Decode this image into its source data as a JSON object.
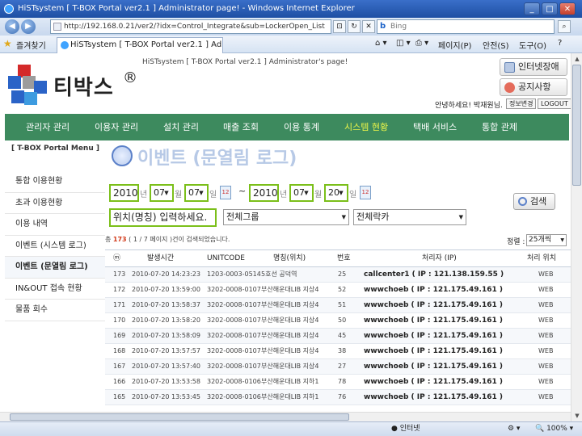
{
  "window": {
    "title": "HiSTsystem [ T-BOX Portal ver2.1 ] Administrator page! - Windows Internet Explorer"
  },
  "browser": {
    "url": "http://192.168.0.21/ver2/?idx=Control_Integrate&sub=LockerOpen_List",
    "search_placeholder": "Bing",
    "favorites_label": "즐겨찾기",
    "tab_title": "HiSTsystem [ T-BOX Portal ver2.1 ] Adminis...",
    "commands": [
      "페이지(P)",
      "안전(S)",
      "도구(O)"
    ]
  },
  "header": {
    "site_title": "HiSTsystem [ T-BOX Portal ver2.1 ] Administrator's page!",
    "logo_text": "티박스",
    "logo_mark": "®",
    "btn_internet": "인터넷장애",
    "btn_notice": "공지사항",
    "user_greeting": "안녕하세요! 박재원님.",
    "btn_info_change": "정보변경",
    "btn_logout": "LOGOUT"
  },
  "main_nav": [
    "관리자 관리",
    "이용자 관리",
    "설치 관리",
    "매출 조회",
    "이용 통계",
    "시스템 현황",
    "택배 서비스",
    "통합 관제"
  ],
  "main_nav_active": "시스템 현황",
  "sidebar": {
    "title": "[ T-BOX Portal Menu ]",
    "items": [
      "통합 이용현황",
      "초과 이용현황",
      "이용 내역",
      "이벤트 (시스템 로그)",
      "이벤트 (문열림 로그)",
      "IN&OUT 접속 현황",
      "물품 회수"
    ],
    "active_index": 4
  },
  "page": {
    "title": "이벤트 (문열림 로그)"
  },
  "filter": {
    "start_year": "2010",
    "start_month": "07",
    "start_day": "07",
    "end_year": "2010",
    "end_month": "07",
    "end_day": "20",
    "unit_year": "년",
    "unit_month": "월",
    "unit_day": "일",
    "tilde": "~",
    "location_placeholder": "위치(명칭) 입력하세요.",
    "group_select": "전체그룹",
    "locker_select": "전체락카",
    "search_button": "검색",
    "cal_icon_text": "12"
  },
  "result": {
    "prefix": "총",
    "total": "173",
    "page_info": "( 1 / 7 페이지 )건이 검색되었습니다.",
    "sort_label": "정렬 :",
    "sort_value": "25개씩"
  },
  "table": {
    "headers": [
      "ⓜ",
      "발생시간",
      "UNITCODE",
      "명칭(위치)",
      "번호",
      "처리자 (IP)",
      "처리 위치"
    ],
    "rows": [
      [
        "173",
        "2010-07-20 14:23:23",
        "1203-0003-0514",
        "5호선 공덕역",
        "25",
        "callcenter1 ( IP : 121.138.159.55 )",
        "WEB"
      ],
      [
        "172",
        "2010-07-20 13:59:00",
        "3202-0008-0107",
        "부산해운대LIB 지상4",
        "52",
        "wwwchoeb ( IP : 121.175.49.161 )",
        "WEB"
      ],
      [
        "171",
        "2010-07-20 13:58:37",
        "3202-0008-0107",
        "부산해운대LIB 지상4",
        "51",
        "wwwchoeb ( IP : 121.175.49.161 )",
        "WEB"
      ],
      [
        "170",
        "2010-07-20 13:58:20",
        "3202-0008-0107",
        "부산해운대LIB 지상4",
        "50",
        "wwwchoeb ( IP : 121.175.49.161 )",
        "WEB"
      ],
      [
        "169",
        "2010-07-20 13:58:09",
        "3202-0008-0107",
        "부산해운대LIB 지상4",
        "45",
        "wwwchoeb ( IP : 121.175.49.161 )",
        "WEB"
      ],
      [
        "168",
        "2010-07-20 13:57:57",
        "3202-0008-0107",
        "부산해운대LIB 지상4",
        "38",
        "wwwchoeb ( IP : 121.175.49.161 )",
        "WEB"
      ],
      [
        "167",
        "2010-07-20 13:57:40",
        "3202-0008-0107",
        "부산해운대LIB 지상4",
        "27",
        "wwwchoeb ( IP : 121.175.49.161 )",
        "WEB"
      ],
      [
        "166",
        "2010-07-20 13:53:58",
        "3202-0008-0106",
        "부산해운대LIB 지하1",
        "78",
        "wwwchoeb ( IP : 121.175.49.161 )",
        "WEB"
      ],
      [
        "165",
        "2010-07-20 13:53:45",
        "3202-0008-0106",
        "부산해운대LIB 지하1",
        "76",
        "wwwchoeb ( IP : 121.175.49.161 )",
        "WEB"
      ]
    ]
  },
  "statusbar": {
    "zone": "인터넷",
    "zoom": "100%"
  }
}
